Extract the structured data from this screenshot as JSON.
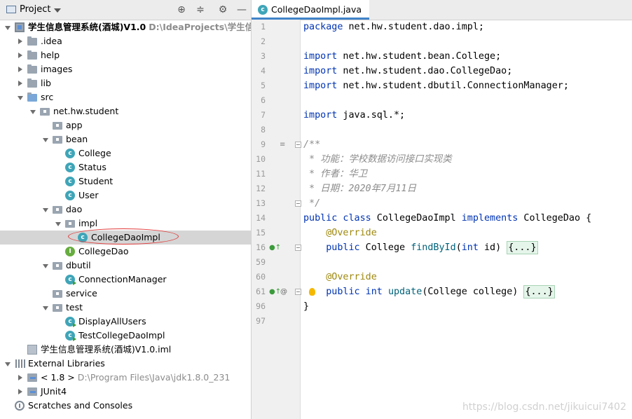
{
  "project_panel": {
    "title": "Project",
    "tree": [
      {
        "name": "学生信息管理系统(酒城)V1.0",
        "path": "D:\\IdeaProjects\\学生信息管",
        "icon": "module-icon",
        "level": 0,
        "state": "open",
        "bold": true
      },
      {
        "name": ".idea",
        "icon": "folder-icon",
        "level": 1,
        "state": "closed"
      },
      {
        "name": "help",
        "icon": "folder-icon",
        "level": 1,
        "state": "closed"
      },
      {
        "name": "images",
        "icon": "folder-icon",
        "level": 1,
        "state": "closed"
      },
      {
        "name": "lib",
        "icon": "folder-icon",
        "level": 1,
        "state": "closed"
      },
      {
        "name": "src",
        "icon": "source-folder-icon",
        "level": 1,
        "state": "open"
      },
      {
        "name": "net.hw.student",
        "icon": "package-icon",
        "level": 2,
        "state": "open"
      },
      {
        "name": "app",
        "icon": "package-icon",
        "level": 3,
        "state": "none"
      },
      {
        "name": "bean",
        "icon": "package-icon",
        "level": 3,
        "state": "open"
      },
      {
        "name": "College",
        "icon": "class-icon",
        "level": 4,
        "state": "none"
      },
      {
        "name": "Status",
        "icon": "class-icon",
        "level": 4,
        "state": "none"
      },
      {
        "name": "Student",
        "icon": "class-icon",
        "level": 4,
        "state": "none"
      },
      {
        "name": "User",
        "icon": "class-icon",
        "level": 4,
        "state": "none"
      },
      {
        "name": "dao",
        "icon": "package-icon",
        "level": 3,
        "state": "open"
      },
      {
        "name": "impl",
        "icon": "package-icon",
        "level": 4,
        "state": "open"
      },
      {
        "name": "CollegeDaoImpl",
        "icon": "class-icon",
        "level": 5,
        "state": "none",
        "selected": true
      },
      {
        "name": "CollegeDao",
        "icon": "interface-icon",
        "level": 4,
        "state": "none"
      },
      {
        "name": "dbutil",
        "icon": "package-icon",
        "level": 3,
        "state": "open"
      },
      {
        "name": "ConnectionManager",
        "icon": "runnable-class-icon",
        "level": 4,
        "state": "none"
      },
      {
        "name": "service",
        "icon": "package-icon",
        "level": 3,
        "state": "none"
      },
      {
        "name": "test",
        "icon": "package-icon",
        "level": 3,
        "state": "open"
      },
      {
        "name": "DisplayAllUsers",
        "icon": "runnable-class-icon",
        "level": 4,
        "state": "none"
      },
      {
        "name": "TestCollegeDaoImpl",
        "icon": "runnable-class-icon",
        "level": 4,
        "state": "none"
      },
      {
        "name": "学生信息管理系统(酒城)V1.0.iml",
        "icon": "iml-file-icon",
        "level": 1,
        "state": "none"
      },
      {
        "name": "External Libraries",
        "icon": "libraries-icon",
        "level": 0,
        "state": "open"
      },
      {
        "name": "< 1.8 >",
        "path": "D:\\Program Files\\Java\\jdk1.8.0_231",
        "icon": "jdk-icon",
        "level": 1,
        "state": "closed"
      },
      {
        "name": "JUnit4",
        "icon": "jdk-icon",
        "level": 1,
        "state": "closed"
      },
      {
        "name": "Scratches and Consoles",
        "icon": "scratches-icon",
        "level": 0,
        "state": "none"
      }
    ]
  },
  "editor": {
    "tab_label": "CollegeDaoImpl.java",
    "lines": [
      {
        "num": "1",
        "segs": [
          [
            "kw",
            "package"
          ],
          [
            "",
            " net.hw.student.dao.impl;"
          ]
        ]
      },
      {
        "num": "2",
        "segs": []
      },
      {
        "num": "3",
        "segs": [
          [
            "kw",
            "import"
          ],
          [
            "",
            " net.hw.student.bean.College;"
          ]
        ]
      },
      {
        "num": "4",
        "segs": [
          [
            "kw",
            "import"
          ],
          [
            "",
            " net.hw.student.dao.CollegeDao;"
          ]
        ]
      },
      {
        "num": "5",
        "segs": [
          [
            "kw",
            "import"
          ],
          [
            "",
            " net.hw.student.dbutil.ConnectionManager;"
          ]
        ]
      },
      {
        "num": "6",
        "segs": []
      },
      {
        "num": "7",
        "segs": [
          [
            "kw",
            "import"
          ],
          [
            "",
            " java.sql.*;"
          ]
        ]
      },
      {
        "num": "8",
        "segs": []
      },
      {
        "num": "9",
        "segs": [
          [
            "com",
            "/**"
          ]
        ],
        "fold": true,
        "doc_toggle": true
      },
      {
        "num": "10",
        "segs": [
          [
            "com",
            " * 功能：学校数据访问接口实现类"
          ]
        ]
      },
      {
        "num": "11",
        "segs": [
          [
            "com",
            " * 作者：华卫"
          ]
        ]
      },
      {
        "num": "12",
        "segs": [
          [
            "com",
            " * 日期：2020年7月11日"
          ]
        ]
      },
      {
        "num": "13",
        "segs": [
          [
            "com",
            " */"
          ]
        ],
        "fold": true
      },
      {
        "num": "14",
        "segs": [
          [
            "kw",
            "public class"
          ],
          [
            "",
            " CollegeDaoImpl "
          ],
          [
            "kw",
            "implements"
          ],
          [
            "",
            " CollegeDao {"
          ]
        ]
      },
      {
        "num": "15",
        "segs": [
          [
            "ann",
            "    @Override"
          ]
        ]
      },
      {
        "num": "16",
        "segs": [
          [
            "kw",
            "    public"
          ],
          [
            "",
            " College "
          ],
          [
            "meth",
            "findById"
          ],
          [
            "",
            "("
          ],
          [
            "kw",
            "int"
          ],
          [
            "",
            " id) "
          ],
          [
            "fold",
            "{...}"
          ]
        ],
        "fold": true,
        "impl_marker": true
      },
      {
        "num": "59",
        "segs": []
      },
      {
        "num": "60",
        "segs": [
          [
            "ann",
            "    @Override"
          ]
        ]
      },
      {
        "num": "61",
        "segs": [
          [
            "kw",
            "    public int"
          ],
          [
            "",
            " "
          ],
          [
            "meth",
            "update"
          ],
          [
            "",
            "(College college) "
          ],
          [
            "fold",
            "{...}"
          ]
        ],
        "fold": true,
        "impl_marker": true,
        "at_marker": true,
        "bulb": true
      },
      {
        "num": "96",
        "segs": [
          [
            "",
            "}"
          ]
        ]
      },
      {
        "num": "97",
        "segs": []
      }
    ]
  },
  "watermark": "https://blog.csdn.net/jikuicui7402"
}
